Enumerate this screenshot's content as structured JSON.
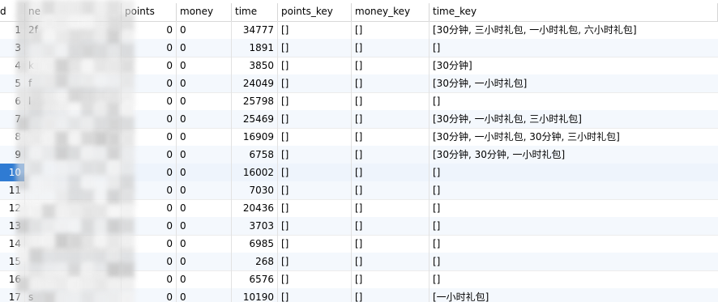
{
  "columns": {
    "id": "d",
    "name": "ne",
    "points": "points",
    "money": "money",
    "time": "time",
    "points_key": "points_key",
    "money_key": "money_key",
    "time_key": "time_key"
  },
  "rows": [
    {
      "id": "1",
      "name": "2f",
      "points": "0",
      "money": "0",
      "time": "34777",
      "points_key": "[]",
      "money_key": "[]",
      "time_key": "[30分钟, 三小时礼包, 一小时礼包, 六小时礼包]"
    },
    {
      "id": "3",
      "name": "",
      "points": "0",
      "money": "0",
      "time": "1891",
      "points_key": "[]",
      "money_key": "[]",
      "time_key": "[]"
    },
    {
      "id": "4",
      "name": "k",
      "points": "0",
      "money": "0",
      "time": "3850",
      "points_key": "[]",
      "money_key": "[]",
      "time_key": "[30分钟]"
    },
    {
      "id": "5",
      "name": "f",
      "points": "0",
      "money": "0",
      "time": "24049",
      "points_key": "[]",
      "money_key": "[]",
      "time_key": "[30分钟, 一小时礼包]"
    },
    {
      "id": "6",
      "name": "l",
      "points": "0",
      "money": "0",
      "time": "25798",
      "points_key": "[]",
      "money_key": "[]",
      "time_key": "[]"
    },
    {
      "id": "7",
      "name": "",
      "points": "0",
      "money": "0",
      "time": "25469",
      "points_key": "[]",
      "money_key": "[]",
      "time_key": "[30分钟, 一小时礼包, 三小时礼包]"
    },
    {
      "id": "8",
      "name": "",
      "points": "0",
      "money": "0",
      "time": "16909",
      "points_key": "[]",
      "money_key": "[]",
      "time_key": "[30分钟, 一小时礼包, 30分钟, 三小时礼包]"
    },
    {
      "id": "9",
      "name": "",
      "points": "0",
      "money": "0",
      "time": "6758",
      "points_key": "[]",
      "money_key": "[]",
      "time_key": "[30分钟, 30分钟, 一小时礼包]"
    },
    {
      "id": "10",
      "name": "",
      "points": "0",
      "money": "0",
      "time": "16002",
      "points_key": "[]",
      "money_key": "[]",
      "time_key": "[]"
    },
    {
      "id": "11",
      "name": "",
      "points": "0",
      "money": "0",
      "time": "7030",
      "points_key": "[]",
      "money_key": "[]",
      "time_key": "[]"
    },
    {
      "id": "12",
      "name": "",
      "points": "0",
      "money": "0",
      "time": "20436",
      "points_key": "[]",
      "money_key": "[]",
      "time_key": "[]"
    },
    {
      "id": "13",
      "name": "",
      "points": "0",
      "money": "0",
      "time": "3703",
      "points_key": "[]",
      "money_key": "[]",
      "time_key": "[]"
    },
    {
      "id": "14",
      "name": "",
      "points": "0",
      "money": "0",
      "time": "6985",
      "points_key": "[]",
      "money_key": "[]",
      "time_key": "[]"
    },
    {
      "id": "15",
      "name": "",
      "points": "0",
      "money": "0",
      "time": "268",
      "points_key": "[]",
      "money_key": "[]",
      "time_key": "[]"
    },
    {
      "id": "16",
      "name": "",
      "points": "0",
      "money": "0",
      "time": "6576",
      "points_key": "[]",
      "money_key": "[]",
      "time_key": "[]"
    },
    {
      "id": "17",
      "name": "s",
      "points": "0",
      "money": "0",
      "time": "10190",
      "points_key": "[]",
      "money_key": "[]",
      "time_key": "[一小时礼包]"
    }
  ],
  "selected_row_id": "10",
  "colors": {
    "selection": "#2f7bd3",
    "alt_row": "#f4f8fd",
    "grid_line": "#e2e2e2"
  }
}
